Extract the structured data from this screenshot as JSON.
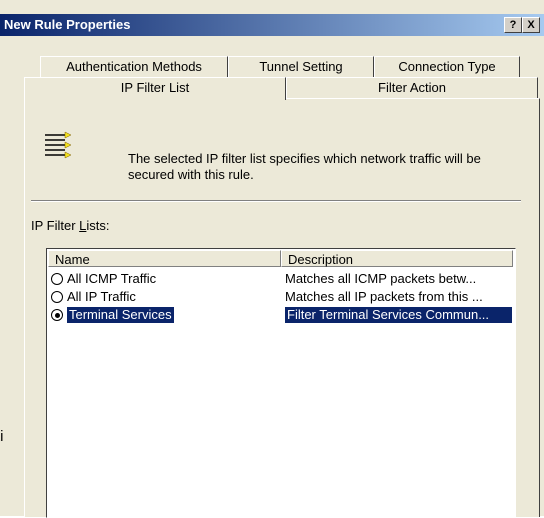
{
  "stray_text": "ti",
  "window": {
    "title": "New Rule Properties",
    "help_label": "?",
    "close_label": "X"
  },
  "tabs": {
    "row1": [
      "Authentication Methods",
      "Tunnel Setting",
      "Connection Type"
    ],
    "row2": [
      "IP Filter List",
      "Filter Action"
    ],
    "active": "IP Filter List"
  },
  "panel": {
    "description": "The selected IP filter list specifies which network traffic will be secured with this rule.",
    "list_label_prefix": "IP Filter ",
    "list_label_accel": "L",
    "list_label_suffix": "ists:",
    "icon": "filter-list-icon"
  },
  "list": {
    "columns": [
      "Name",
      "Description"
    ],
    "rows": [
      {
        "name": "All ICMP Traffic",
        "description": "Matches all ICMP packets betw...",
        "selected": false
      },
      {
        "name": "All IP Traffic",
        "description": "Matches all IP packets from this ...",
        "selected": false
      },
      {
        "name": "Terminal Services",
        "description": "Filter Terminal Services Commun...",
        "selected": true
      }
    ]
  },
  "colors": {
    "title_bar": "#0a246a",
    "selection": "#0a246a",
    "dialog_bg": "#ece9d8"
  }
}
